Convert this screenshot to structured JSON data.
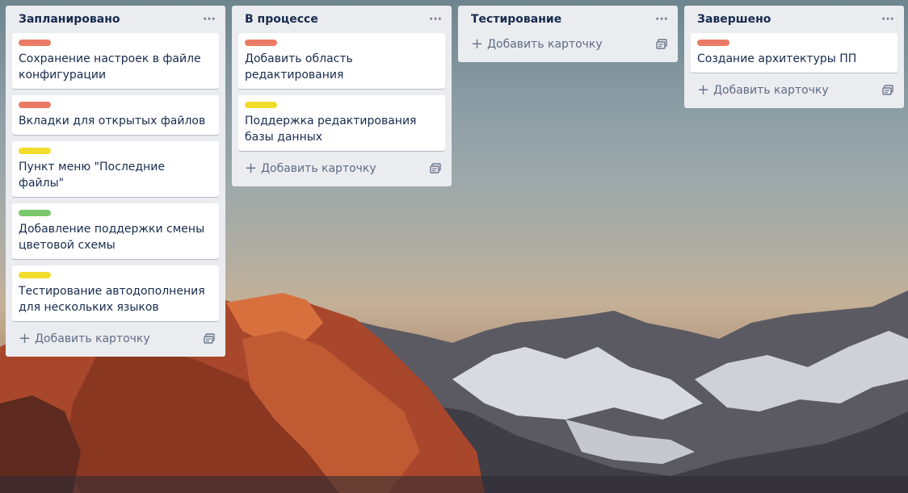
{
  "colors": {
    "red": "#eb7a65",
    "yellow": "#f2dd2c",
    "green": "#7bc86c"
  },
  "lists": [
    {
      "title": "Запланировано",
      "menu": "···",
      "add_label": "Добавить карточку",
      "cards": [
        {
          "label": "red",
          "title": "Сохранение настроек в файле конфигурации"
        },
        {
          "label": "red",
          "title": "Вкладки для открытых файлов"
        },
        {
          "label": "yellow",
          "title": "Пункт меню \"Последние файлы\""
        },
        {
          "label": "green",
          "title": "Добавление поддержки смены цветовой схемы"
        },
        {
          "label": "yellow",
          "title": "Тестирование автодополнения для нескольких языков"
        }
      ]
    },
    {
      "title": "В процессе",
      "menu": "···",
      "add_label": "Добавить карточку",
      "cards": [
        {
          "label": "red",
          "title": "Добавить область редактирования"
        },
        {
          "label": "yellow",
          "title": "Поддержка редактирования базы данных"
        }
      ]
    },
    {
      "title": "Тестирование",
      "menu": "···",
      "add_label": "Добавить карточку",
      "cards": []
    },
    {
      "title": "Завершено",
      "menu": "···",
      "add_label": "Добавить карточку",
      "cards": [
        {
          "label": "red",
          "title": "Создание архитектуры ПП"
        }
      ]
    }
  ]
}
